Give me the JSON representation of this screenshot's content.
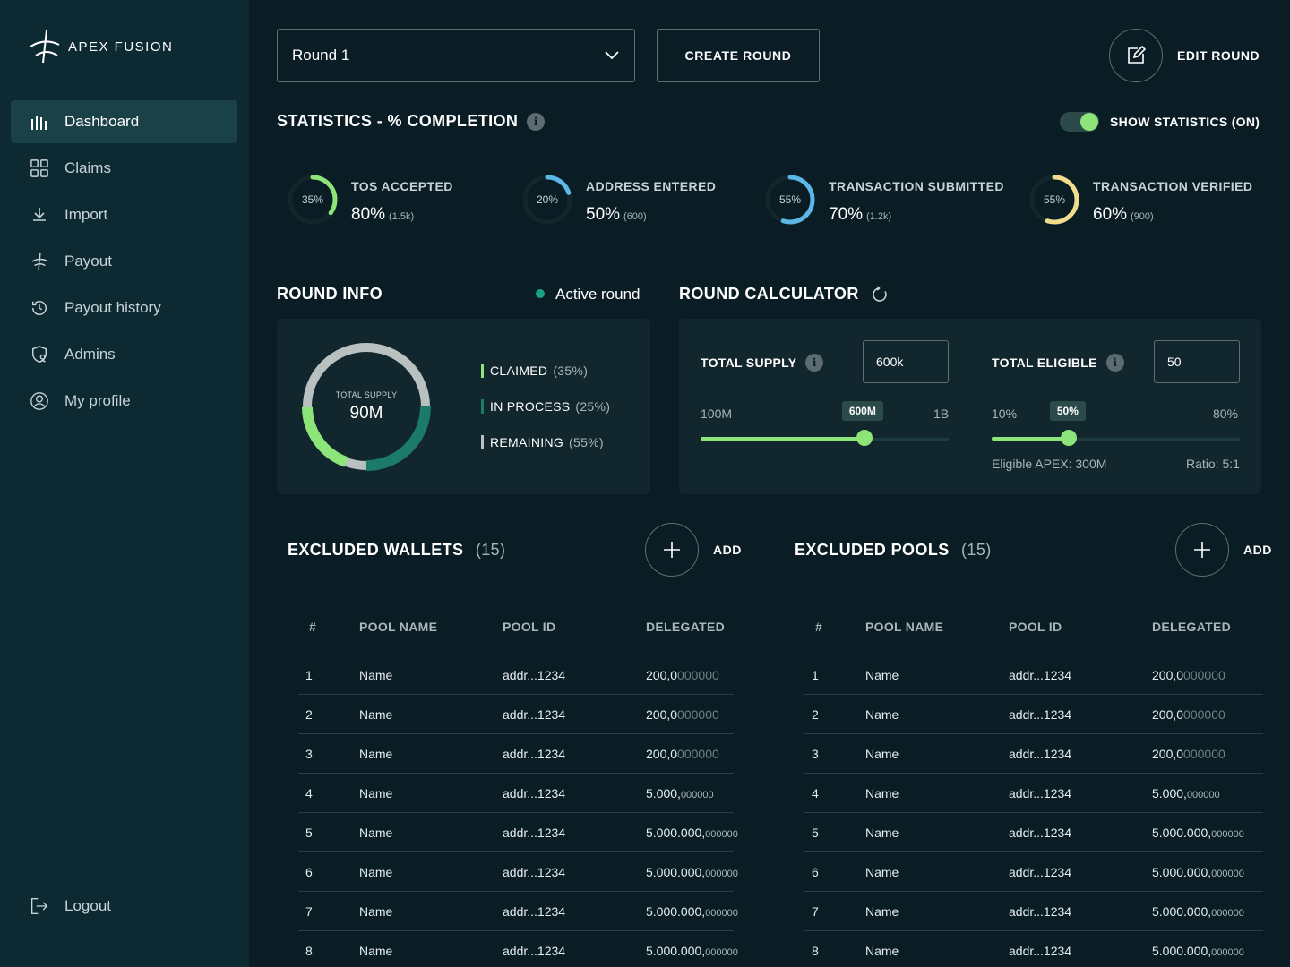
{
  "sidebar": {
    "logo_text": "APEX FUSION",
    "items": [
      {
        "label": "Dashboard",
        "icon": "bar-chart-icon",
        "active": true
      },
      {
        "label": "Claims",
        "icon": "grid-icon"
      },
      {
        "label": "Import",
        "icon": "download-icon"
      },
      {
        "label": "Payout",
        "icon": "apex-icon"
      },
      {
        "label": "Payout history",
        "icon": "history-icon"
      },
      {
        "label": "Admins",
        "icon": "shield-user-icon"
      },
      {
        "label": "My profile",
        "icon": "user-circle-icon"
      }
    ],
    "logout_label": "Logout"
  },
  "toolbar": {
    "round_selected": "Round 1",
    "create_round": "CREATE ROUND",
    "edit_round": "EDIT ROUND"
  },
  "statistics": {
    "title": "STATISTICS - % COMPLETION",
    "toggle_label": "SHOW STATISTICS (ON)",
    "toggle_on": true,
    "items": [
      {
        "ring_pct": "35%",
        "ring_value": 0.35,
        "color": "#8de57a",
        "label": "TOS ACCEPTED",
        "value": "80%",
        "sub": "(1.5k)"
      },
      {
        "ring_pct": "20%",
        "ring_value": 0.2,
        "color": "#5bb7e6",
        "label": "ADDRESS ENTERED",
        "value": "50%",
        "sub": "(600)"
      },
      {
        "ring_pct": "55%",
        "ring_value": 0.55,
        "color": "#5bb7e6",
        "label": "TRANSACTION SUBMITTED",
        "value": "70%",
        "sub": "(1.2k)"
      },
      {
        "ring_pct": "55%",
        "ring_value": 0.55,
        "color": "#f0dc8c",
        "label": "TRANSACTION VERIFIED",
        "value": "60%",
        "sub": "(900)"
      }
    ]
  },
  "round_info": {
    "title": "ROUND INFO",
    "status": "Active round",
    "donut_label": "TOTAL SUPPLY",
    "donut_value": "90M",
    "legend": [
      {
        "label": "CLAIMED",
        "pct": "(35%)",
        "value": 0.35,
        "color": "#8de57a"
      },
      {
        "label": "IN PROCESS",
        "pct": "(25%)",
        "value": 0.25,
        "color": "#1c7a6a"
      },
      {
        "label": "REMAINING",
        "pct": "(55%)",
        "value": 0.55,
        "color": "#b9c1c0"
      }
    ]
  },
  "calculator": {
    "title": "ROUND CALCULATOR",
    "supply": {
      "label": "TOTAL SUPPLY",
      "input": "600k",
      "min": "100M",
      "max": "1B",
      "badge": "600M",
      "fraction": 0.66
    },
    "eligible": {
      "label": "TOTAL ELIGIBLE",
      "input": "50",
      "min": "10%",
      "max": "80%",
      "badge": "50%",
      "fraction": 0.31
    },
    "eligible_apex": "Eligible APEX: 300M",
    "ratio": "Ratio: 5:1"
  },
  "wallets": {
    "title": "EXCLUDED WALLETS",
    "count": "(15)",
    "add_label": "ADD",
    "headers": [
      "#",
      "POOL NAME",
      "POOL ID",
      "DELEGATED"
    ],
    "rows": [
      {
        "n": "1",
        "name": "Name",
        "id": "addr...1234",
        "int": "200,0",
        "dec": "000000",
        "small": false
      },
      {
        "n": "2",
        "name": "Name",
        "id": "addr...1234",
        "int": "200,0",
        "dec": "000000",
        "small": false
      },
      {
        "n": "3",
        "name": "Name",
        "id": "addr...1234",
        "int": "200,0",
        "dec": "000000",
        "small": false
      },
      {
        "n": "4",
        "name": "Name",
        "id": "addr...1234",
        "int": "5.000,",
        "dec": "000000",
        "small": true
      },
      {
        "n": "5",
        "name": "Name",
        "id": "addr...1234",
        "int": "5.000.000,",
        "dec": "000000",
        "small": true
      },
      {
        "n": "6",
        "name": "Name",
        "id": "addr...1234",
        "int": "5.000.000,",
        "dec": "000000",
        "small": true
      },
      {
        "n": "7",
        "name": "Name",
        "id": "addr...1234",
        "int": "5.000.000,",
        "dec": "000000",
        "small": true
      },
      {
        "n": "8",
        "name": "Name",
        "id": "addr...1234",
        "int": "5.000.000,",
        "dec": "000000",
        "small": true
      }
    ]
  },
  "pools": {
    "title": "EXCLUDED POOLS",
    "count": "(15)",
    "add_label": "ADD",
    "headers": [
      "#",
      "POOL NAME",
      "POOL ID",
      "DELEGATED"
    ],
    "rows": [
      {
        "n": "1",
        "name": "Name",
        "id": "addr...1234",
        "int": "200,0",
        "dec": "000000",
        "small": false
      },
      {
        "n": "2",
        "name": "Name",
        "id": "addr...1234",
        "int": "200,0",
        "dec": "000000",
        "small": false
      },
      {
        "n": "3",
        "name": "Name",
        "id": "addr...1234",
        "int": "200,0",
        "dec": "000000",
        "small": false
      },
      {
        "n": "4",
        "name": "Name",
        "id": "addr...1234",
        "int": "5.000,",
        "dec": "000000",
        "small": true
      },
      {
        "n": "5",
        "name": "Name",
        "id": "addr...1234",
        "int": "5.000.000,",
        "dec": "000000",
        "small": true
      },
      {
        "n": "6",
        "name": "Name",
        "id": "addr...1234",
        "int": "5.000.000,",
        "dec": "000000",
        "small": true
      },
      {
        "n": "7",
        "name": "Name",
        "id": "addr...1234",
        "int": "5.000.000,",
        "dec": "000000",
        "small": true
      },
      {
        "n": "8",
        "name": "Name",
        "id": "addr...1234",
        "int": "5.000.000,",
        "dec": "000000",
        "small": true
      }
    ]
  },
  "colors": {
    "accent": "#8de57a",
    "background": "#0a1c24",
    "sidebar": "#0d2a33"
  }
}
